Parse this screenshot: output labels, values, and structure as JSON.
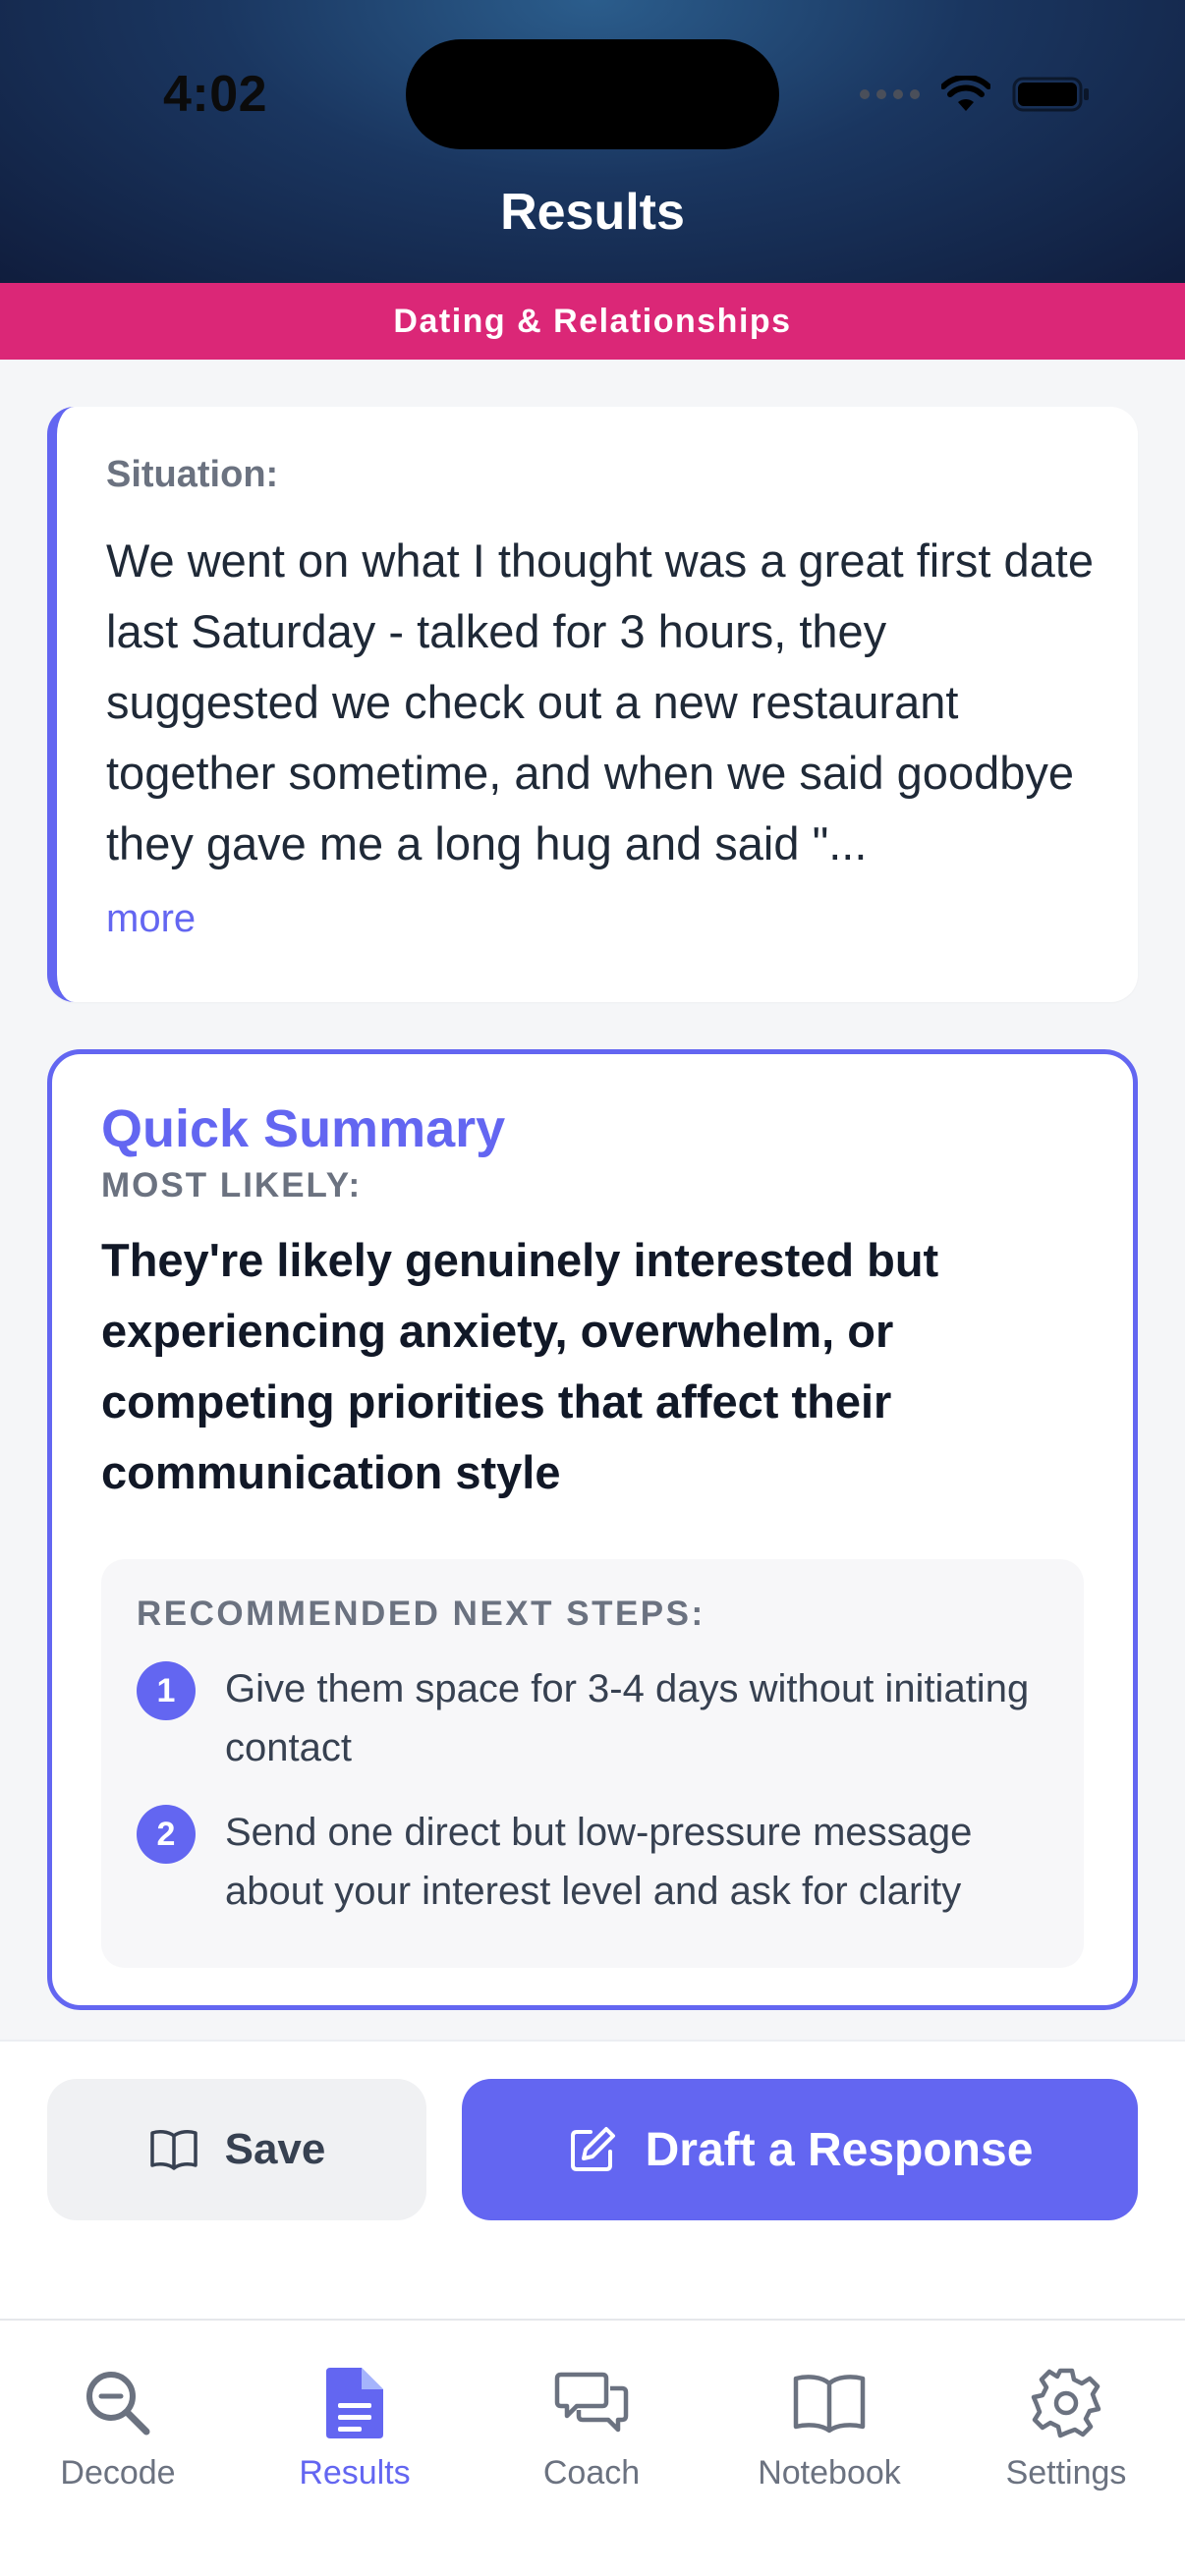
{
  "status_bar": {
    "time": "4:02"
  },
  "header": {
    "title": "Results"
  },
  "category": {
    "label": "Dating & Relationships"
  },
  "situation": {
    "label": "Situation:",
    "text": "We went on what I thought was a great first date last Saturday - talked for 3 hours, they suggested we check out a new restaurant together sometime, and when we said goodbye they gave me a long hug and said \"...",
    "more_label": "more"
  },
  "summary": {
    "title": "Quick Summary",
    "subtitle": "MOST LIKELY:",
    "text": "They're likely genuinely interested but experiencing anxiety, overwhelm, or competing priorities that affect their communication style",
    "steps_heading": "RECOMMENDED NEXT STEPS:",
    "steps": [
      {
        "number": "1",
        "text": "Give them space for 3-4 days without initiating contact"
      },
      {
        "number": "2",
        "text": "Send one direct but low-pressure message about your interest level and ask for clarity"
      }
    ]
  },
  "actions": {
    "save_label": "Save",
    "draft_label": "Draft a Response"
  },
  "tabs": [
    {
      "label": "Decode",
      "icon": "search-icon",
      "active": false
    },
    {
      "label": "Results",
      "icon": "document-icon",
      "active": true
    },
    {
      "label": "Coach",
      "icon": "chat-icon",
      "active": false
    },
    {
      "label": "Notebook",
      "icon": "book-icon",
      "active": false
    },
    {
      "label": "Settings",
      "icon": "gear-icon",
      "active": false
    }
  ],
  "colors": {
    "accent": "#6366f1",
    "category_banner": "#db2777",
    "header_dark": "#101d3d"
  }
}
